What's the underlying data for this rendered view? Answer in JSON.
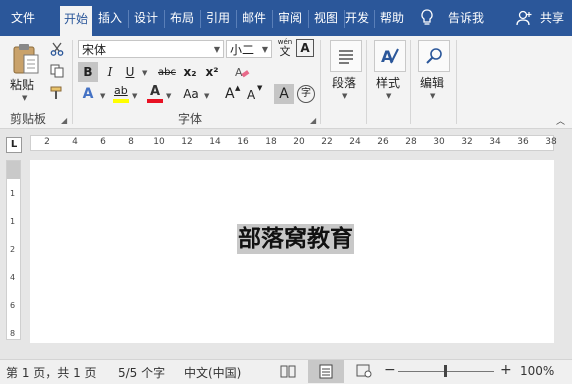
{
  "tabs": [
    "文件",
    "开始",
    "插入",
    "设计",
    "布局",
    "引用",
    "邮件",
    "审阅",
    "视图",
    "开发",
    "帮助"
  ],
  "tell_me": "告诉我",
  "share": "共享",
  "clipboard": {
    "paste_label": "粘贴",
    "group_label": "剪贴板",
    "icons": [
      "cut-icon",
      "copy-icon",
      "format-painter-icon"
    ]
  },
  "font": {
    "name": "宋体",
    "size": "小二",
    "wen_glyph": "wén",
    "wen_char": "文",
    "box_a": "A",
    "bold": "B",
    "italic": "I",
    "underline": "U",
    "strike": "abc",
    "subscript": "x₂",
    "superscript": "x²",
    "text_effect": "A",
    "highlight": "ab",
    "font_color": "A",
    "change_case": "Aa",
    "grow": "A",
    "shrink": "A",
    "shading": "A",
    "enclose": "字",
    "group_label": "字体"
  },
  "paragraph": {
    "label": "段落"
  },
  "styles": {
    "label": "样式"
  },
  "editing": {
    "label": "编辑"
  },
  "ruler": {
    "tab_marker": "L",
    "marks": [
      "2",
      "4",
      "6",
      "8",
      "10",
      "12",
      "14",
      "16",
      "18",
      "20",
      "22",
      "24",
      "26",
      "28",
      "30",
      "32",
      "34",
      "36",
      "38"
    ],
    "vmarks": [
      "1",
      "1",
      "2",
      "4",
      "6",
      "8"
    ]
  },
  "document": {
    "text": "部落窝教育"
  },
  "status": {
    "page": "第 1 页，共 1 页",
    "words": "5/5 个字",
    "language": "中文(中国)",
    "zoom": "100%",
    "zoom_minus": "−",
    "zoom_plus": "+"
  },
  "colors": {
    "brand": "#2b579a",
    "highlight": "#ffff00",
    "font_color": "#e81123"
  }
}
